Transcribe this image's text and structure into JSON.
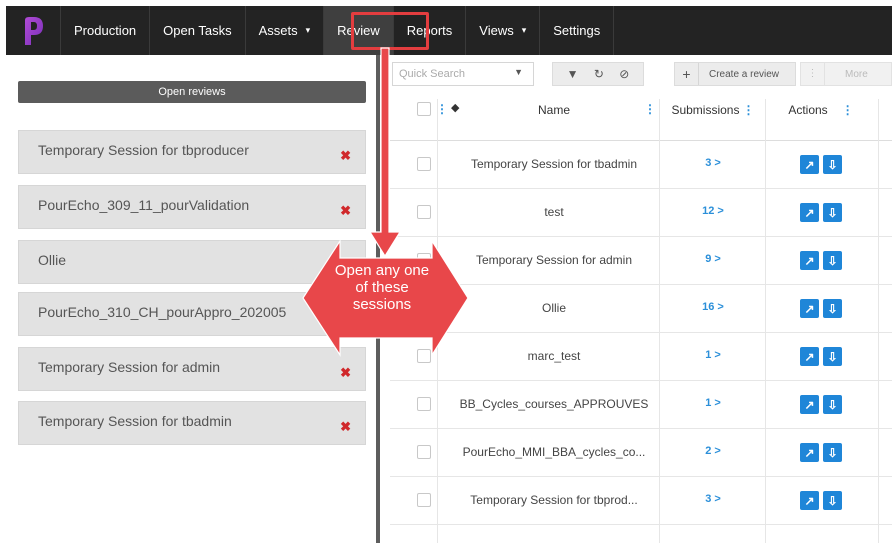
{
  "nav": {
    "items": [
      {
        "label": "Production"
      },
      {
        "label": "Open Tasks"
      },
      {
        "label": "Assets",
        "caret": "▾"
      },
      {
        "label": "Review"
      },
      {
        "label": "Reports"
      },
      {
        "label": "Views",
        "caret": "▾"
      },
      {
        "label": "Settings"
      }
    ]
  },
  "left": {
    "open_reviews_label": "Open reviews",
    "sessions": [
      {
        "label": "Temporary Session for tbproducer"
      },
      {
        "label": "PourEcho_309_11_pourValidation"
      },
      {
        "label": "Ollie"
      },
      {
        "label": "PourEcho_310_CH_pourAppro_202005"
      },
      {
        "label": "Temporary Session for admin"
      },
      {
        "label": "Temporary Session for tbadmin"
      }
    ],
    "remove_glyph": "✖"
  },
  "toolbar": {
    "quick_search_placeholder": "Quick Search",
    "create_label": "Create a review",
    "more_label": "More"
  },
  "grid": {
    "headers": {
      "name": "Name",
      "submissions": "Submissions",
      "actions": "Actions"
    },
    "rows": [
      {
        "name": "Temporary Session for tbadmin",
        "submissions": "3 >"
      },
      {
        "name": "test",
        "submissions": "12 >"
      },
      {
        "name": "Temporary Session for admin",
        "submissions": "9 >"
      },
      {
        "name": "Ollie",
        "submissions": "16 >"
      },
      {
        "name": "marc_test",
        "submissions": "1 >"
      },
      {
        "name": "BB_Cycles_courses_APPROUVES",
        "submissions": "1 >"
      },
      {
        "name": "PourEcho_MMI_BBA_cycles_co...",
        "submissions": "2 >"
      },
      {
        "name": "Temporary Session for tbprod...",
        "submissions": "3 >"
      }
    ]
  },
  "callout": {
    "line1": "Open any one",
    "line2": "of these",
    "line3": "sessions",
    "color": "#e8474a"
  }
}
